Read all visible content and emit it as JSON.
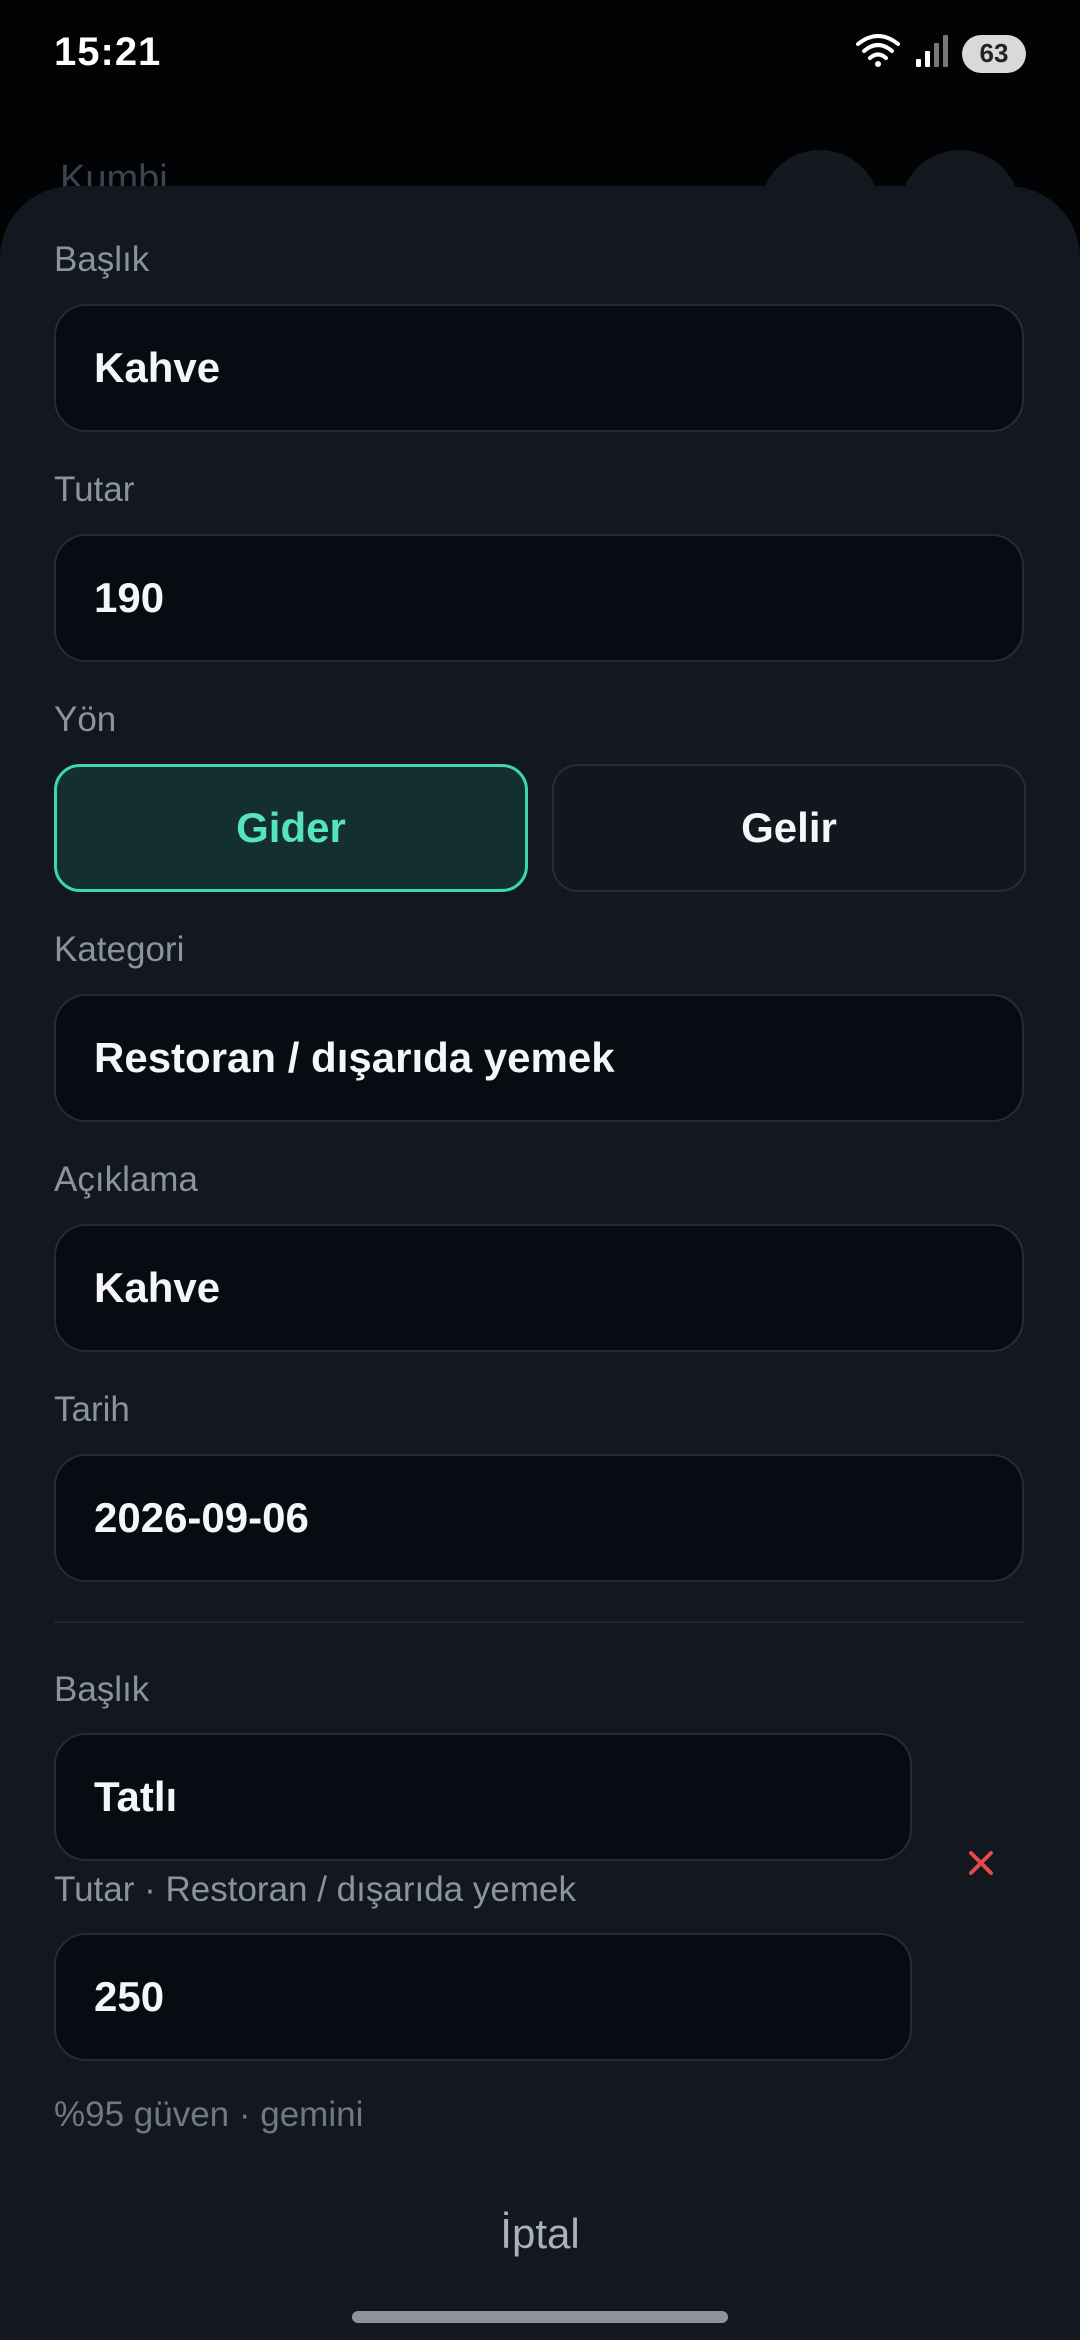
{
  "status_bar": {
    "time": "15:21",
    "battery": "63",
    "icons": [
      "wifi-icon",
      "signal-icon",
      "battery-icon"
    ]
  },
  "background": {
    "title": "Kumbi"
  },
  "form": {
    "title_label": "Başlık",
    "title_value": "Kahve",
    "amount_label": "Tutar",
    "amount_value": "190",
    "direction_label": "Yön",
    "direction_options": [
      "Gider",
      "Gelir"
    ],
    "direction_selected": "Gider",
    "category_label": "Kategori",
    "category_value": "Restoran / dışarıda yemek",
    "description_label": "Açıklama",
    "description_value": "Kahve",
    "date_label": "Tarih",
    "date_value": "2026-09-06"
  },
  "item": {
    "title_label": "Başlık",
    "title_value": "Tatlı",
    "amount_label": "Tutar · Restoran / dışarıda yemek",
    "amount_value": "250",
    "meta": "%95 güven · gemini",
    "remove_icon": "close-icon"
  },
  "actions": {
    "cancel_label": "İptal"
  },
  "colors": {
    "accent": "#3dd6b2",
    "danger": "#e5484d",
    "sheet_bg": "#131820",
    "field_bg": "#080b11"
  }
}
